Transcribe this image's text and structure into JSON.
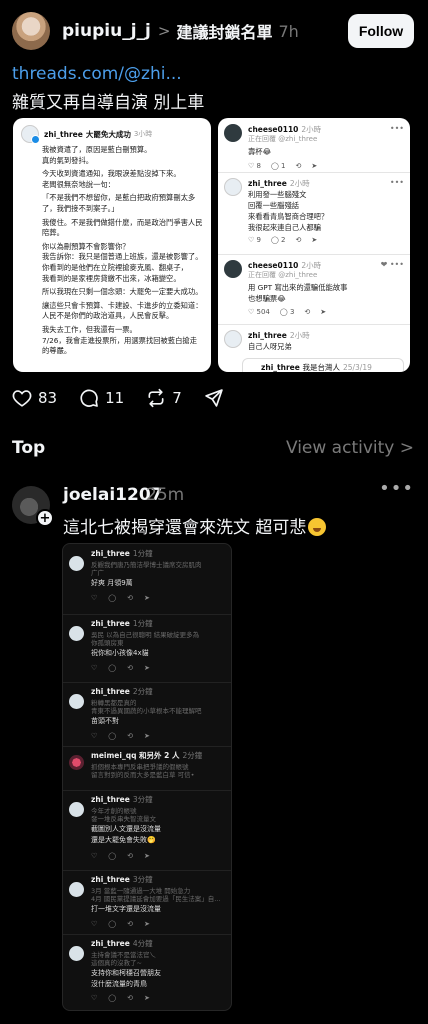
{
  "post": {
    "author": "piupiu_j_j",
    "crumb_chevron": ">",
    "crumb_title": "建議封鎖名單",
    "time": "7h",
    "follow_label": "Follow",
    "link": "threads.com/@zhi...",
    "text": "雜質又再自導自演 別上車"
  },
  "shot_left": {
    "name": "zhi_three",
    "crumb": "大罷免大成功",
    "time": "3小時",
    "paragraphs": [
      "我被資遣了，原因是藍白刪預算。\n真的氣到發抖。",
      "今天收到資遣通知，我眼淚差點沒掉下來。\n老闆很無奈地說一句：",
      "「不是我們不想留你，是藍白把政府預算刪太多了，我們接不到案子。」",
      "我傻住。不是我們做錯什麼，而是政治鬥爭害人民陪葬。",
      "你以為刪預算不會影響你？\n我告訴你：我只是個普通上班族，還是被影響了。\n你看到的是他們在立院裡搶麥克風、翻桌子，\n我看到的是家裡房貸繳不出來，冰箱變空。",
      "所以我現在只剩一個念頭：大罷免一定要大成功。",
      "讓這些只會卡預算、卡建設、卡進步的立委知道：\n人民不是你們的政治道具，人民會反擊。",
      "我失去工作，但我還有一票。\n7/26，我會走進投票所，用選票找回被藍白搶走的尊嚴。"
    ]
  },
  "shot_right": {
    "c1": {
      "name": "cheese0110",
      "time": "2小時",
      "reply": "正在回覆 @zhi_three",
      "text": "壽杯😂",
      "likes": "8",
      "replies": "1"
    },
    "c2": {
      "name": "zhi_three",
      "time": "2小時",
      "text": "利用發一些腦殘文\n回覆一些腦殘話\n來看看青鳥智商合理吧？\n我很起來連自己人都騙",
      "likes": "9",
      "replies": "2"
    },
    "c3": {
      "name": "cheese0110",
      "time": "2小時",
      "reply": "正在回覆 @zhi_three",
      "text": "用 GPT 寫出來的還騙低能故事\n也想騙票😂",
      "likes": "504",
      "replies": "3"
    },
    "c4": {
      "name": "zhi_three",
      "time": "2小時",
      "text": "自己人呀兄弟"
    },
    "c5": {
      "name": "zhi_three",
      "text": "我是台灣人",
      "time": "25/3/19"
    }
  },
  "actions": {
    "likes": "83",
    "comments": "11",
    "reposts": "7"
  },
  "section": {
    "top_label": "Top",
    "view_activity": "View activity >"
  },
  "reply": {
    "author": "joelai1207",
    "time": "25m",
    "plus": "+",
    "text": "這北七被揭穿還會來洗文 超可悲"
  },
  "dark_shot": {
    "items": [
      {
        "name": "zhi_three",
        "time": "1分鐘",
        "faint": "反觀我們唐乃簡洁學博士議席交房肌肉",
        "faint2": "广广",
        "text": "好爽 月領9萬"
      },
      {
        "name": "zhi_three",
        "time": "1分鐘",
        "faint": "吳民 以為自己很聰明 結果破綻更多為",
        "faint2": "你孤頭房東",
        "text": "祝你和小孩像4x貓"
      },
      {
        "name": "zhi_three",
        "time": "2分鐘",
        "faint": "粉轉黑都是真的",
        "faint2": "青東不過異國蔬的小草根本不能理解吧",
        "text": "苗頭不對"
      },
      {
        "name": "meimei_qq 和另外 2 人",
        "time": "2分鐘",
        "faint": "抓個根本專門反串把爭議的假帳號",
        "faint2": "留言對到的反而大多是藍白草 可信•",
        "text": ""
      },
      {
        "name": "zhi_three",
        "time": "3分鐘",
        "faint": "今年才創的帳號",
        "faint2": "發一堆反串失智流量文",
        "text": "截圖別人文還是沒流量\n還是大罷免會失敗🤭"
      },
      {
        "name": "zhi_three",
        "time": "3分鐘",
        "faint": "3月 當藍一隨通過一大堆 開始急力",
        "faint2": "4月 國民黨提議延會加要過「民生法案」自...",
        "text": "打一堆文字還是沒流量"
      },
      {
        "name": "zhi_three",
        "time": "4分鐘",
        "faint": "主持會議不是當法官乀",
        "faint2": "這個真的沒救了~",
        "text": "支持你和柯穩召營朋友\n沒什麼流量的青鳥"
      }
    ]
  },
  "colors": {
    "background": "#000000",
    "link": "#4c9eea",
    "muted": "#777777",
    "follow_bg": "#f3f5f7"
  },
  "icons": [
    "heart-icon",
    "comment-icon",
    "repost-icon",
    "share-icon",
    "chevron-right-icon",
    "more-icon",
    "plus-icon"
  ]
}
